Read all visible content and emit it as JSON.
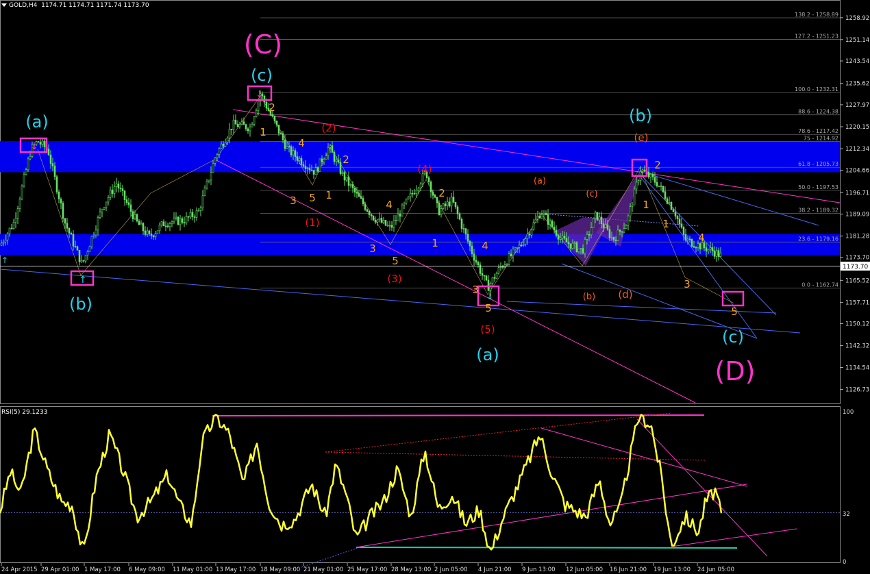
{
  "header": {
    "symbol": "GOLD,H4",
    "ohlc": "1174.71 1174.71 1171.74 1173.70"
  },
  "rsi_header": "RSI(5) 29.1233",
  "colors": {
    "background": "#000000",
    "candle": "#66e066",
    "zone": "#0000ee",
    "pink": "#ff33cc",
    "magenta_label": "#ff33cc",
    "cyan_label": "#22d3ee",
    "orange_label": "#f5a623",
    "red_label": "#ee1111",
    "rsi_line": "#ffff33",
    "fib": "#666666",
    "trendline_blue": "#4466ee"
  },
  "chart_data": [
    {
      "type": "candlestick",
      "symbol": "GOLD",
      "timeframe": "H4",
      "ylim": [
        1122.0,
        1264.0
      ],
      "y_ticks": [
        1258.92,
        1251.14,
        1243.54,
        1235.62,
        1227.97,
        1220.15,
        1212.34,
        1204.66,
        1196.71,
        1189.09,
        1181.28,
        1173.7,
        1165.52,
        1157.71,
        1150.12,
        1142.32,
        1134.54,
        1126.73
      ],
      "x_ticks": [
        "24 Apr 2015",
        "29 Apr 01:00",
        "1 May 17:00",
        "6 May 09:00",
        "11 May 01:00",
        "13 May 17:00",
        "18 May 09:00",
        "21 May 01:00",
        "25 May 17:00",
        "28 May 13:00",
        "2 Jun 05:00",
        "4 Jun 21:00",
        "9 Jun 13:00",
        "12 Jun 05:00",
        "16 Jun 21:00",
        "19 Jun 13:00",
        "24 Jun 05:00"
      ],
      "current_price": 1173.7,
      "fib_levels": [
        {
          "label": "138.2 - 1258.89",
          "price": 1258.89
        },
        {
          "label": "127.2 - 1251.23",
          "price": 1251.23
        },
        {
          "label": "100.0 - 1232.31",
          "price": 1232.31
        },
        {
          "label": "88.6 - 1224.38",
          "price": 1224.38
        },
        {
          "label": "78.6 - 1217.42",
          "price": 1217.42
        },
        {
          "label": "75 - 1214.92",
          "price": 1214.92
        },
        {
          "label": "61.8 - 1205.73",
          "price": 1205.73
        },
        {
          "label": "50.0 - 1197.53",
          "price": 1197.53
        },
        {
          "label": "38.2 - 1189.32",
          "price": 1189.32
        },
        {
          "label": "23.6 - 1179.16",
          "price": 1179.16
        },
        {
          "label": "0.0 - 1162.74",
          "price": 1162.74
        }
      ],
      "zones": [
        {
          "from": 1204.0,
          "to": 1215.0
        },
        {
          "from": 1174.5,
          "to": 1182.0
        }
      ],
      "wave_labels": [
        {
          "text": "(C)",
          "color": "magenta",
          "size": "xl"
        },
        {
          "text": "(D)",
          "color": "magenta",
          "size": "xl"
        },
        {
          "text": "(a)",
          "color": "cyan",
          "size": "l"
        },
        {
          "text": "(b)",
          "color": "cyan",
          "size": "l"
        },
        {
          "text": "(c)",
          "color": "cyan",
          "size": "l"
        },
        {
          "text": "(1)",
          "color": "red"
        },
        {
          "text": "(2)",
          "color": "red"
        },
        {
          "text": "(3)",
          "color": "red"
        },
        {
          "text": "(4)",
          "color": "red"
        },
        {
          "text": "(5)",
          "color": "red"
        },
        {
          "text": "(e)",
          "color": "orange-red"
        },
        {
          "text": "(d)",
          "color": "orange-red"
        },
        {
          "text": "1",
          "color": "orange"
        },
        {
          "text": "2",
          "color": "orange"
        },
        {
          "text": "3",
          "color": "orange"
        },
        {
          "text": "4",
          "color": "orange"
        },
        {
          "text": "5",
          "color": "orange"
        }
      ]
    },
    {
      "type": "line",
      "name": "RSI(5)",
      "value": 29.1233,
      "ylim": [
        0,
        100
      ],
      "y_ticks": [
        100,
        32,
        0
      ],
      "level": 32
    }
  ]
}
